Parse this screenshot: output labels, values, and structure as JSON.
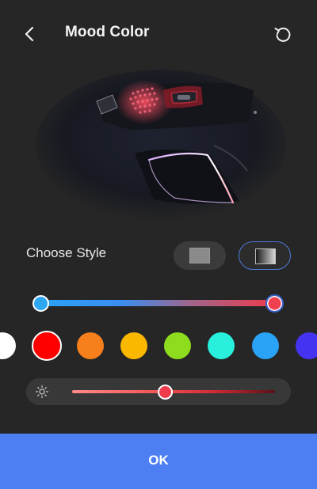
{
  "header": {
    "title": "Mood Color",
    "back_icon": "chevron-left-icon",
    "reset_icon": "rotate-ccw-icon"
  },
  "preview": {
    "image": "car-interior-ambient-light"
  },
  "style": {
    "label": "Choose Style",
    "options": [
      "solid",
      "gradient"
    ],
    "selected": "gradient"
  },
  "gradient": {
    "start_color": "#2ea7f2",
    "end_color": "#ef4050"
  },
  "colors": {
    "options": [
      "#ffffff",
      "#ff0000",
      "#f77f1c",
      "#fbb800",
      "#8edc1e",
      "#28f0dc",
      "#2aa2f5",
      "#4433f0"
    ],
    "selected": 1
  },
  "brightness": {
    "icon": "sun-icon",
    "value": 0.46
  },
  "ok_button": {
    "label": "OK"
  }
}
